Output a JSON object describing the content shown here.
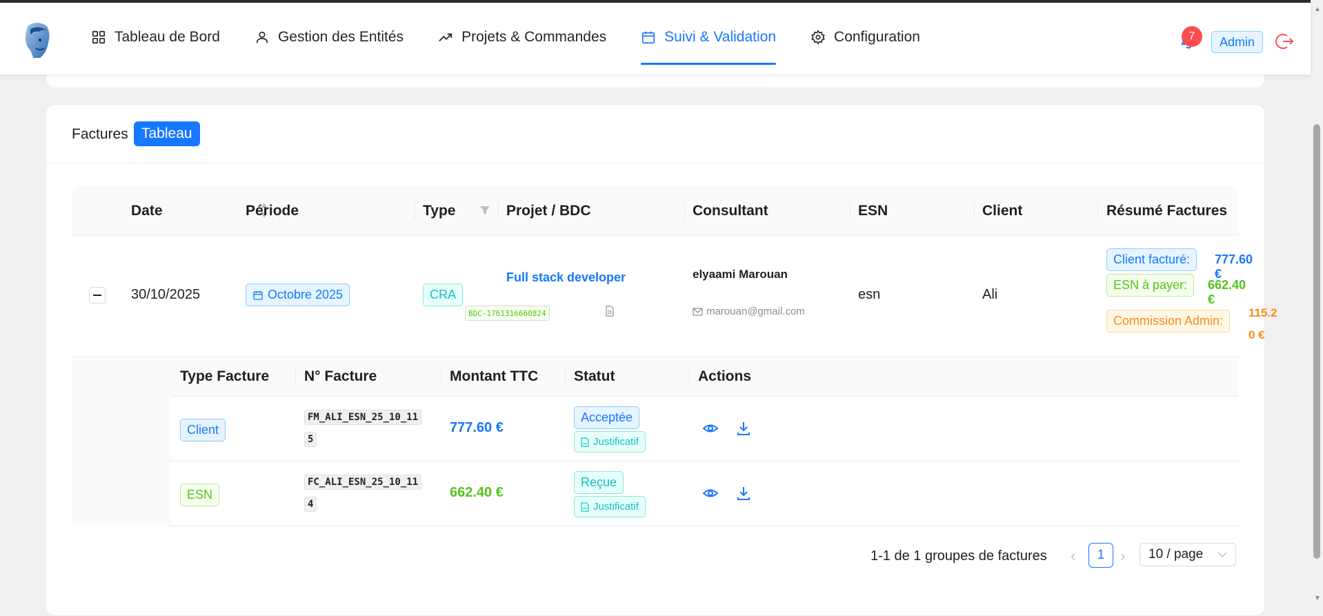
{
  "nav": {
    "items": [
      {
        "label": "Tableau de Bord",
        "icon": "dashboard-icon"
      },
      {
        "label": "Gestion des Entités",
        "icon": "user-icon"
      },
      {
        "label": "Projets & Commandes",
        "icon": "trend-icon"
      },
      {
        "label": "Suivi & Validation",
        "icon": "calendar-icon",
        "active": true
      },
      {
        "label": "Configuration",
        "icon": "gear-icon"
      }
    ],
    "notifications": "7",
    "role": "Admin"
  },
  "card": {
    "title": "Factures",
    "view_tag": "Tableau"
  },
  "table": {
    "columns": [
      "Date",
      "Période",
      "Type",
      "Projet / BDC",
      "Consultant",
      "ESN",
      "Client",
      "Résumé Factures"
    ],
    "row": {
      "date": "30/10/2025",
      "period": "Octobre 2025",
      "type": "CRA",
      "project": "Full stack developer",
      "bdc": "BDC-1761316660824",
      "consultant_name": "elyaami Marouan",
      "consultant_email": "marouan@gmail.com",
      "esn": "esn",
      "client": "Ali",
      "summary": {
        "client_label": "Client facturé:",
        "client_value": "777.60 €",
        "esn_label": "ESN à payer:",
        "esn_value": "662.40 €",
        "commission_label": "Commission Admin:",
        "commission_value_line1": "115.2",
        "commission_value_line2": "0 €"
      }
    }
  },
  "invoices": {
    "columns": [
      "Type Facture",
      "N° Facture",
      "Montant TTC",
      "Statut",
      "Actions"
    ],
    "rows": [
      {
        "type": "Client",
        "number_line1": "FM_ALI_ESN_25_10_11",
        "number_line2": "5",
        "amount": "777.60 €",
        "status": "Acceptée",
        "proof": "Justificatif"
      },
      {
        "type": "ESN",
        "number_line1": "FC_ALI_ESN_25_10_11",
        "number_line2": "4",
        "amount": "662.40 €",
        "status": "Reçue",
        "proof": "Justificatif"
      }
    ]
  },
  "pagination": {
    "summary": "1-1 de 1 groupes de factures",
    "current_page": "1",
    "page_size": "10 / page"
  },
  "colors": {
    "primary": "#1677ff",
    "success": "#52c41a",
    "warning": "#fa8c16",
    "danger": "#ff4d4f"
  }
}
